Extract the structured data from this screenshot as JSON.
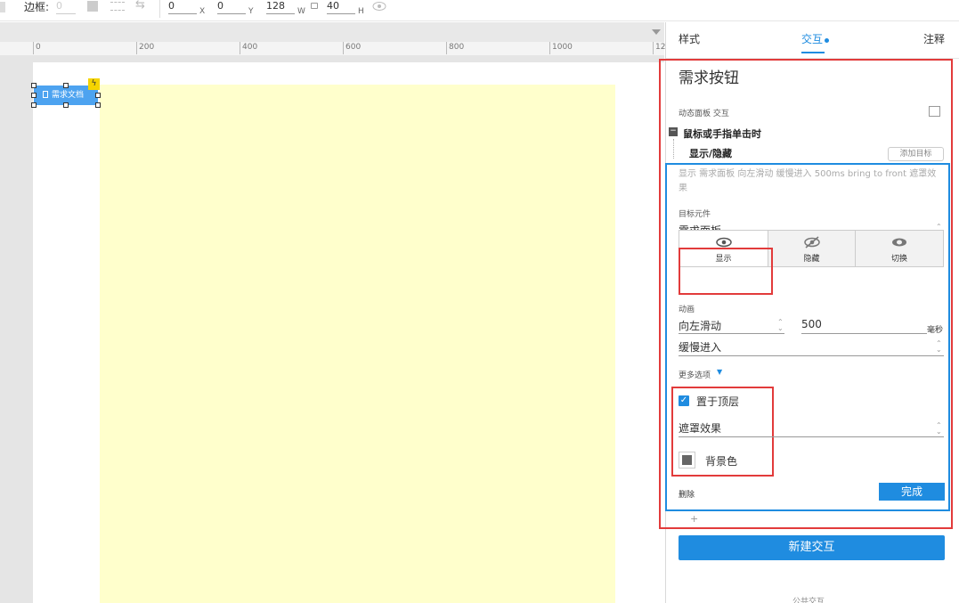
{
  "toolbar": {
    "border_label": "边框:",
    "border_value": "0",
    "x_value": "0",
    "x_label": "X",
    "y_value": "0",
    "y_label": "Y",
    "w_value": "128",
    "w_label": "W",
    "h_value": "40",
    "h_label": "H"
  },
  "ruler": {
    "ticks": [
      "0",
      "200",
      "400",
      "600",
      "800",
      "1000",
      "12"
    ]
  },
  "canvas": {
    "widget_label": "需求文档"
  },
  "sidebar": {
    "tabs": [
      "样式",
      "交互",
      "注释"
    ],
    "widget_title": "需求按钮",
    "section_label": "动态面板 交互",
    "event_label": "鼠标或手指单击时",
    "action_label": "显示/隐藏",
    "add_target_button": "添加目标",
    "action_summary": "显示 需求面板 向左滑动 缓慢进入 500ms bring to front 遮罩效果",
    "target_label": "目标元件",
    "target_value": "需求面板",
    "visibility_options": [
      "显示",
      "隐藏",
      "切换"
    ],
    "animation_label": "动画",
    "animation_value": "向左滑动",
    "duration_value": "500",
    "duration_unit": "毫秒",
    "easing_value": "缓慢进入",
    "more_options_label": "更多选项",
    "bring_to_front_label": "置于顶层",
    "overlay_effect_value": "遮罩效果",
    "bg_color_label": "背景色",
    "delete_label": "删除",
    "done_button": "完成",
    "new_interaction_button": "新建交互",
    "shared_interactions_label": "公共交互"
  },
  "colors": {
    "accent": "#1f8ce0",
    "highlight": "#e23b3b",
    "panel": "#ffffcc",
    "widget": "#4da3f0"
  }
}
